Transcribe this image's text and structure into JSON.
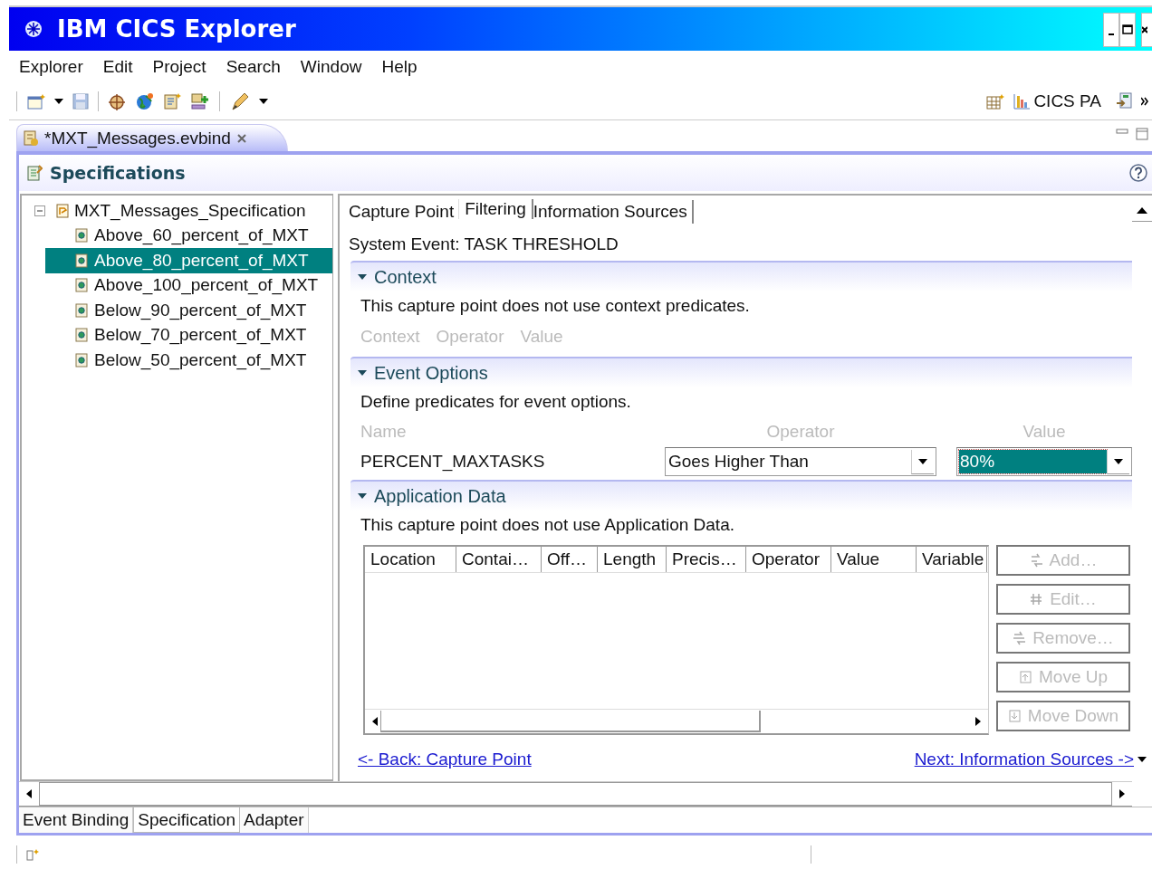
{
  "window": {
    "title": "IBM CICS Explorer"
  },
  "menu": [
    "Explorer",
    "Edit",
    "Project",
    "Search",
    "Window",
    "Help"
  ],
  "toolbar": {
    "perspective": "CICS PA"
  },
  "editor_tab": {
    "title": "*MXT_Messages.evbind"
  },
  "page": {
    "title": "Specifications"
  },
  "tree": {
    "label": "MXT_Messages_Specification",
    "expanded": true,
    "children": [
      {
        "label": "Above_60_percent_of_MXT",
        "selected": false
      },
      {
        "label": "Above_80_percent_of_MXT",
        "selected": true
      },
      {
        "label": "Above_100_percent_of_MXT",
        "selected": false
      },
      {
        "label": "Below_90_percent_of_MXT",
        "selected": false
      },
      {
        "label": "Below_70_percent_of_MXT",
        "selected": false
      },
      {
        "label": "Below_50_percent_of_MXT",
        "selected": false
      }
    ]
  },
  "tabs": [
    {
      "label": "Capture Point",
      "selected": false
    },
    {
      "label": "Filtering",
      "selected": true
    },
    {
      "label": "Information Sources",
      "selected": false
    }
  ],
  "system_event": "System Event: TASK THRESHOLD",
  "sections": [
    {
      "kind": "predicates",
      "title": "Context",
      "expanded": true,
      "description": "This capture point does not use context predicates.",
      "columns": [
        "Context",
        "Operator",
        "Value"
      ]
    },
    {
      "kind": "options",
      "title": "Event Options",
      "expanded": true,
      "description": "Define predicates for event options.",
      "columns": [
        "Name",
        "Operator",
        "Value"
      ],
      "rows": [
        {
          "name": "PERCENT_MAXTASKS",
          "operator": "Goes Higher Than",
          "value": "80%",
          "value_highlighted": true
        }
      ]
    },
    {
      "kind": "table",
      "title": "Application Data",
      "expanded": true,
      "description": "This capture point does not use Application Data.",
      "columns": [
        "Location",
        "Contai…",
        "Off…",
        "Length",
        "Precis…",
        "Operator",
        "Value",
        "Variable"
      ],
      "buttons": [
        {
          "label": "Add…",
          "disabled": true
        },
        {
          "label": "Edit…",
          "disabled": true
        },
        {
          "label": "Remove…",
          "disabled": true
        },
        {
          "label": "Move Up",
          "disabled": true
        },
        {
          "label": "Move Down",
          "disabled": true
        }
      ]
    }
  ],
  "links": {
    "back": "<- Back: Capture Point",
    "next": "Next: Information Sources ->"
  },
  "bottom_tabs": [
    {
      "label": "Event Binding",
      "selected": false
    },
    {
      "label": "Specification",
      "selected": true
    },
    {
      "label": "Adapter",
      "selected": false
    }
  ]
}
